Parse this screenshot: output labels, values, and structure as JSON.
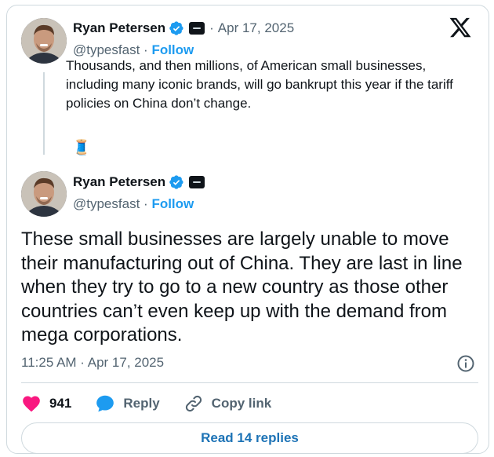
{
  "quoted_tweet": {
    "author_name": "Ryan Petersen",
    "handle": "@typesfast",
    "separator": "·",
    "follow_label": "Follow",
    "date": "Apr 17, 2025",
    "text": "Thousands, and then millions, of American small businesses, including many iconic brands, will go bankrupt this year if the tariff policies on China  don’t change.",
    "emoji": "🧵"
  },
  "main_tweet": {
    "author_name": "Ryan Petersen",
    "handle": "@typesfast",
    "separator": "·",
    "follow_label": "Follow",
    "text": "These small businesses are largely unable to move their manufacturing out of China. They are last in line when they try to go to a new country as those other countries can’t even keep up with the demand from mega corporations.",
    "timestamp": "11:25 AM · Apr 17, 2025"
  },
  "actions": {
    "like_count": "941",
    "reply_label": "Reply",
    "copy_link_label": "Copy link"
  },
  "read_replies_label": "Read 14 replies",
  "icons": {
    "logo": "x-logo-icon",
    "verified": "verified-badge-icon",
    "affiliation": "affiliate-badge-icon",
    "like": "heart-icon",
    "reply": "speech-bubble-icon",
    "copy": "link-icon",
    "info": "info-icon"
  },
  "colors": {
    "accent": "#1d9bf0",
    "like": "#f91880",
    "muted": "#536471",
    "text": "#0f1419",
    "border": "#cfd9de"
  }
}
